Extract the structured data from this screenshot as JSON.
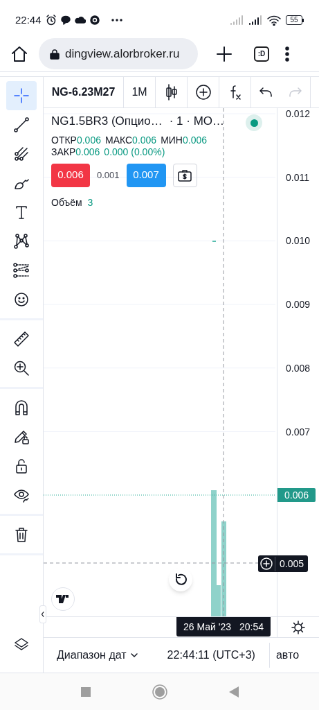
{
  "status_bar": {
    "time": "22:44",
    "battery": "55"
  },
  "browser": {
    "url": "dingview.alorbroker.ru",
    "tab_button": ":D"
  },
  "toolbar": {
    "symbol": "NG-6.23M27",
    "interval": "1M",
    "redo_disabled": true
  },
  "drawing_tools": [
    [
      {
        "selected": true
      },
      {
        "selected": false
      },
      {
        "selected": false
      },
      {
        "selected": false
      },
      {
        "selected": false
      },
      {
        "selected": false
      },
      {
        "selected": false
      },
      {
        "selected": false
      }
    ],
    [
      {
        "selected": false
      },
      {
        "selected": false
      }
    ],
    [
      {
        "selected": false
      },
      {
        "selected": false
      },
      {
        "selected": false
      },
      {
        "selected": false
      }
    ],
    [
      {
        "selected": false
      }
    ]
  ],
  "legend": {
    "title": "NG1.5BR3 (Опцио…",
    "meta": "· 1 · МО…",
    "ohlc": [
      {
        "label": "ОТКР",
        "value": "0.006"
      },
      {
        "label": "МАКС",
        "value": "0.006"
      },
      {
        "label": "МИН",
        "value": "0.006"
      },
      {
        "label": "ЗАКР",
        "value": "0.006"
      }
    ],
    "change": "0.000 (0.00%)",
    "sell": "0.006",
    "spread": "0.001",
    "buy": "0.007",
    "volume": {
      "label": "Объём",
      "value": "3"
    }
  },
  "price_axis": {
    "ticks": [
      "0.012",
      "0.011",
      "0.010",
      "0.009",
      "0.008",
      "0.007"
    ],
    "last_price": "0.006",
    "crosshair_price": "0.005"
  },
  "time_axis": {
    "crosshair_date": "26 Май '23",
    "crosshair_time": "20:54"
  },
  "footer": {
    "date_range": "Диапазон дат",
    "clock": "22:44:11 (UTC+3)",
    "scale": "авто"
  }
}
